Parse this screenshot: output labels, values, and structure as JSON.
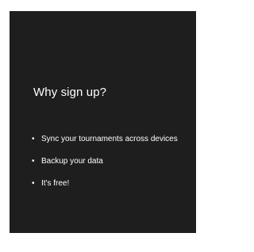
{
  "signup_info": {
    "title": "Why sign up?",
    "reasons": [
      {
        "text": "Sync your tournaments across devices"
      },
      {
        "text": "Backup your data"
      },
      {
        "text": "It's free!"
      }
    ]
  },
  "colors": {
    "panel_background": "#1e1e1e",
    "page_background": "#ffffff",
    "text": "#ffffff"
  },
  "icons": {
    "bullet": "bullet-icon"
  }
}
